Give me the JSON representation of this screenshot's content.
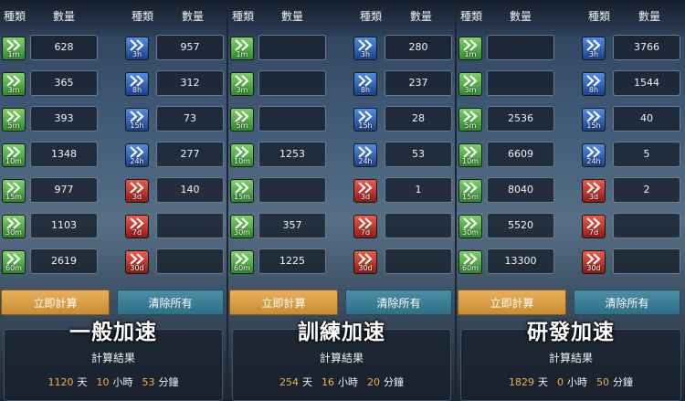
{
  "headers": {
    "type": "種類",
    "qty": "數量"
  },
  "buttons": {
    "calculate": "立即計算",
    "clear": "清除所有"
  },
  "result_label": "計算結果",
  "units": {
    "day": "天",
    "hour": "小時",
    "minute": "分鐘"
  },
  "panels": [
    {
      "title": "一般加速",
      "left": [
        {
          "tier": "1m",
          "value": "628"
        },
        {
          "tier": "3m",
          "value": "365"
        },
        {
          "tier": "5m",
          "value": "393"
        },
        {
          "tier": "10m",
          "value": "1348"
        },
        {
          "tier": "15m",
          "value": "977"
        },
        {
          "tier": "30m",
          "value": "1103"
        },
        {
          "tier": "60m",
          "value": "2619"
        }
      ],
      "right": [
        {
          "tier": "3h",
          "value": "957"
        },
        {
          "tier": "8h",
          "value": "312"
        },
        {
          "tier": "15h",
          "value": "73"
        },
        {
          "tier": "24h",
          "value": "277"
        },
        {
          "tier": "3d",
          "value": "140"
        },
        {
          "tier": "7d",
          "value": ""
        },
        {
          "tier": "30d",
          "value": ""
        }
      ],
      "result": {
        "days": "1120",
        "hours": "10",
        "minutes": "53"
      }
    },
    {
      "title": "訓練加速",
      "left": [
        {
          "tier": "1m",
          "value": ""
        },
        {
          "tier": "3m",
          "value": ""
        },
        {
          "tier": "5m",
          "value": ""
        },
        {
          "tier": "10m",
          "value": "1253"
        },
        {
          "tier": "15m",
          "value": ""
        },
        {
          "tier": "30m",
          "value": "357"
        },
        {
          "tier": "60m",
          "value": "1225"
        }
      ],
      "right": [
        {
          "tier": "3h",
          "value": "280"
        },
        {
          "tier": "8h",
          "value": "237"
        },
        {
          "tier": "15h",
          "value": "28"
        },
        {
          "tier": "24h",
          "value": "53"
        },
        {
          "tier": "3d",
          "value": "1"
        },
        {
          "tier": "7d",
          "value": ""
        },
        {
          "tier": "30d",
          "value": ""
        }
      ],
      "result": {
        "days": "254",
        "hours": "16",
        "minutes": "20"
      }
    },
    {
      "title": "研發加速",
      "left": [
        {
          "tier": "1m",
          "value": ""
        },
        {
          "tier": "3m",
          "value": ""
        },
        {
          "tier": "5m",
          "value": "2536"
        },
        {
          "tier": "10m",
          "value": "6609"
        },
        {
          "tier": "15m",
          "value": "8040"
        },
        {
          "tier": "30m",
          "value": "5520"
        },
        {
          "tier": "60m",
          "value": "13300"
        }
      ],
      "right": [
        {
          "tier": "3h",
          "value": "3766"
        },
        {
          "tier": "8h",
          "value": "1544"
        },
        {
          "tier": "15h",
          "value": "40"
        },
        {
          "tier": "24h",
          "value": "5"
        },
        {
          "tier": "3d",
          "value": "2"
        },
        {
          "tier": "7d",
          "value": ""
        },
        {
          "tier": "30d",
          "value": ""
        }
      ],
      "result": {
        "days": "1829",
        "hours": "0",
        "minutes": "50"
      }
    }
  ]
}
